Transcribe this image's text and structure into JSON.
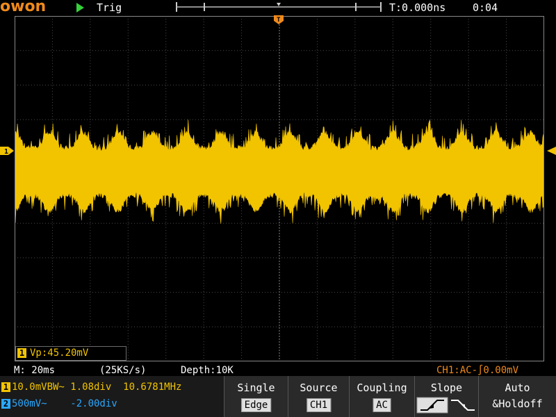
{
  "header": {
    "logo": "owon",
    "trigger_status": "Trig",
    "time_offset": "T:0.000ns",
    "clock": "0:04"
  },
  "colors": {
    "ch1": "#f2c400",
    "ch2": "#2aa8ff",
    "accent": "#f08a1c",
    "run": "#36d13a"
  },
  "measurement": {
    "badge": "1",
    "text": "Vp:45.20mV"
  },
  "status_bar": {
    "timebase": "M: 20ms",
    "sample_rate": "(25KS/s)",
    "depth": "Depth:10K",
    "trigger_info": "CH1:AC-∫0.00mV"
  },
  "channels": [
    {
      "badge": "1",
      "text": "10.0mVBW~ 1.08div  10.6781MHz"
    },
    {
      "badge": "2",
      "text": "500mV~    -2.00div"
    }
  ],
  "menu": {
    "single": {
      "title": "Single",
      "value": "Edge"
    },
    "source": {
      "title": "Source",
      "value": "CH1"
    },
    "coupling": {
      "title": "Coupling",
      "value": "AC"
    },
    "slope": {
      "title": "Slope"
    },
    "auto": {
      "title": "Auto",
      "line2": "&Holdoff"
    }
  },
  "markers": {
    "ch1": "1",
    "trigger_position": "T"
  }
}
